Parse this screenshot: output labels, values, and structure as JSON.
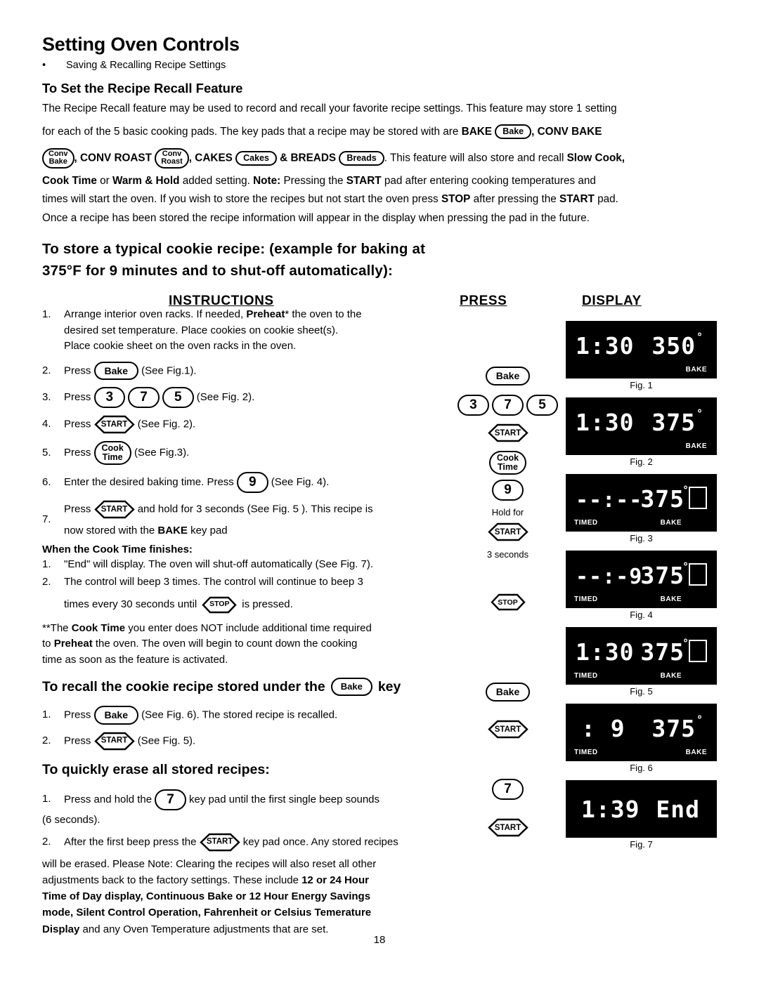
{
  "header": {
    "title": "Setting Oven Controls",
    "bullet": "Saving & Recalling Recipe Settings"
  },
  "section1": {
    "heading": "To Set the Recipe Recall Feature",
    "p1_a": "The Recipe Recall feature may be used to record and recall your favorite recipe settings. This feature may store 1 setting",
    "p1_b": "for each of the 5 basic cooking pads. The key pads that a recipe may be stored with are ",
    "p1_bake_bold": "BAKE",
    "p1_pad_bake": "Bake",
    "p1_c": ", ",
    "p1_convbake_bold": "CONV BAKE",
    "p1_pad_conv_l1": "Conv",
    "p1_pad_conv_l2": "Bake",
    "p1_d": ", ",
    "p1_convroast_bold": "CONV ROAST",
    "p1_pad_roast_l1": "Conv",
    "p1_pad_roast_l2": "Roast",
    "p1_e": ", ",
    "p1_cakes_bold": "CAKES",
    "p1_pad_cakes": "Cakes",
    "p1_f": " & ",
    "p1_breads_bold": "BREADS",
    "p1_pad_breads": "Breads",
    "p1_g": ". This feature will also store and recall ",
    "p1_slowcook_bold": "Slow Cook,",
    "p2_a": "Cook Time",
    "p2_b": " or ",
    "p2_c": "Warm & Hold",
    "p2_d": " added setting. ",
    "p2_note": "Note:",
    "p2_e": " Pressing the ",
    "p2_start": "START",
    "p2_f": " pad after entering cooking temperatures and",
    "p3_a": "times will start the oven. If you wish to store the recipes but not start the oven press ",
    "p3_stop": "STOP",
    "p3_b": " after pressing the ",
    "p3_start": "START",
    "p3_c": " pad.",
    "p4": "Once a recipe has been stored  the recipe information will appear in the display when pressing the pad in the future."
  },
  "section2": {
    "heading_l1": "To store a typical cookie recipe: (example for baking at",
    "heading_l2": "375°F for 9 minutes and to shut-off automatically):"
  },
  "columns": {
    "instructions": "INSTRUCTIONS",
    "press": "PRESS",
    "display": "DISPLAY"
  },
  "steps": [
    {
      "n": "1.",
      "lines": [
        "Arrange interior oven racks. If needed, Preheat* the oven to the",
        "desired set temperature. Place cookies on cookie sheet(s).",
        "Place cookie sheet on the oven racks in the oven."
      ],
      "bold_word": "Preheat"
    },
    {
      "n": "2.",
      "text_before": "Press",
      "pad": "Bake",
      "text_after": "(See Fig.1)."
    },
    {
      "n": "3.",
      "text_before": "Press",
      "pads": [
        "3",
        "7",
        "5"
      ],
      "text_after": "(See Fig. 2)."
    },
    {
      "n": "4.",
      "text_before": "Press",
      "pad": "START",
      "text_after": "(See Fig. 2)."
    },
    {
      "n": "5.",
      "text_before": "Press",
      "pad_l1": "Cook",
      "pad_l2": "Time",
      "text_after": "(See Fig.3)."
    },
    {
      "n": "6.",
      "text_before": "Enter the desired baking time. Press",
      "pad": "9",
      "text_after": "(See Fig. 4)."
    },
    {
      "n": "7.",
      "text_before": "Press",
      "pad": "START",
      "text_after": "and hold for 3 seconds (See Fig. 5 ). This recipe is",
      "line2_a": "now stored with the ",
      "line2_bold": "BAKE",
      "line2_b": " key pad"
    }
  ],
  "cook_finish": {
    "heading": "When the Cook Time finishes:",
    "item1": "\"End\" will display. The oven will shut-off automatically (See Fig. 7).",
    "item1_n": "1.",
    "item2_n": "2.",
    "item2": "The control will beep 3 times. The control will continue to beep 3",
    "item2_line2_a": "times every 30 seconds until",
    "item2_pad": "STOP",
    "item2_line2_b": "is pressed."
  },
  "preheat_note": {
    "l1_a": "**The ",
    "l1_bold": "Cook Time",
    "l1_b": " you enter does NOT include additional time required",
    "l2_a": "to ",
    "l2_bold": "Preheat",
    "l2_b": " the oven. The oven will begin to count down the cooking",
    "l3": "time as soon as the feature is activated."
  },
  "section3": {
    "heading_a": "To recall the cookie recipe stored under the",
    "heading_pad": "Bake",
    "heading_b": "key",
    "item1_n": "1.",
    "item1_before": "Press",
    "item1_pad": "Bake",
    "item1_after": "(See Fig. 6). The stored recipe is recalled.",
    "item2_n": "2.",
    "item2_before": "Press",
    "item2_pad": "START",
    "item2_after": "(See Fig. 5)."
  },
  "section4": {
    "heading": "To quickly erase all stored recipes:",
    "item1_n": "1.",
    "item1_before": "Press and hold the",
    "item1_pad": "7",
    "item1_after": "key pad until the first single beep sounds",
    "item1_line2": "(6 seconds).",
    "item2_n": "2.",
    "item2_before": "After the first beep press the",
    "item2_pad": "START",
    "item2_after": "key pad once.  Any stored recipes",
    "tail_l1": "will be erased. Please Note: Clearing the recipes will also reset all other",
    "tail_l2_a": "adjustments back to the factory settings. These include ",
    "tail_l2_bold": "12 or 24 Hour",
    "tail_l3_bold": "Time of Day display,  Continuous Bake or 12 Hour Energy Savings",
    "tail_l4_bold": "mode, Silent Control Operation, Fahrenheit or Celsius Temerature",
    "tail_l5_bold": "Display",
    "tail_l5_a": " and any Oven Temperature adjustments that are set."
  },
  "press_column": {
    "items": [
      {
        "type": "pad",
        "label": "Bake"
      },
      {
        "type": "nums",
        "labels": [
          "3",
          "7",
          "5"
        ]
      },
      {
        "type": "start",
        "label": "START"
      },
      {
        "type": "pad2",
        "l1": "Cook",
        "l2": "Time"
      },
      {
        "type": "num",
        "label": "9"
      },
      {
        "type": "text",
        "label": "Hold for"
      },
      {
        "type": "start",
        "label": "START"
      },
      {
        "type": "text",
        "label": "3  seconds"
      },
      {
        "type": "stop",
        "label": "STOP"
      },
      {
        "type": "pad",
        "label": "Bake"
      },
      {
        "type": "start",
        "label": "START"
      },
      {
        "type": "num",
        "label": "7"
      },
      {
        "type": "start",
        "label": "START"
      }
    ]
  },
  "displays": [
    {
      "time": "1:30",
      "temp": "350",
      "deg": "°",
      "bake": "BAKE",
      "timed": "",
      "box": false,
      "caption": "Fig. 1"
    },
    {
      "time": "1:30",
      "temp": "375",
      "deg": "°",
      "bake": "BAKE",
      "timed": "",
      "box": false,
      "caption": "Fig. 2"
    },
    {
      "time": "--:--",
      "temp": "375",
      "deg": "°",
      "bake": "BAKE",
      "timed": "TIMED",
      "box": true,
      "caption": "Fig. 3"
    },
    {
      "time": "--:-9",
      "temp": "375",
      "deg": "°",
      "bake": "BAKE",
      "timed": "TIMED",
      "box": true,
      "caption": "Fig. 4"
    },
    {
      "time": "1:30",
      "temp": "375",
      "deg": "°",
      "bake": "BAKE",
      "timed": "TIMED",
      "box": true,
      "caption": "Fig. 5"
    },
    {
      "time": ":  9",
      "temp": "375",
      "deg": "°",
      "bake": "BAKE",
      "timed": "TIMED",
      "box": false,
      "caption": "Fig. 6"
    },
    {
      "time": "1:39",
      "temp": "End",
      "deg": "",
      "bake": "",
      "timed": "",
      "box": false,
      "caption": "Fig. 7"
    }
  ],
  "page_number": "18"
}
